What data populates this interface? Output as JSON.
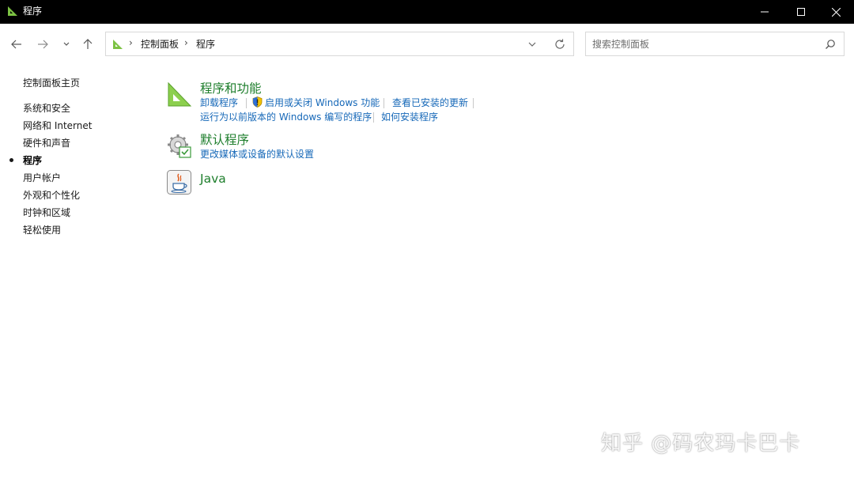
{
  "window": {
    "title": "程序",
    "controls": [
      "minimize-icon",
      "maximize-icon",
      "close-icon"
    ]
  },
  "navigation": {
    "back_icon": "arrow-left-icon",
    "forward_icon": "arrow-right-icon",
    "recent_icon": "chevron-down-icon",
    "up_icon": "arrow-up-icon"
  },
  "address": {
    "breadcrumbs": [
      "控制面板",
      "程序"
    ],
    "separator": "›"
  },
  "search": {
    "placeholder": "搜索控制面板",
    "value": ""
  },
  "sidebar": {
    "items": [
      {
        "label": "控制面板主页"
      },
      {
        "label": "系统和安全"
      },
      {
        "label": "网络和 Internet"
      },
      {
        "label": "硬件和声音"
      },
      {
        "label": "程序",
        "current": true
      },
      {
        "label": "用户帐户"
      },
      {
        "label": "外观和个性化"
      },
      {
        "label": "时钟和区域"
      },
      {
        "label": "轻松使用"
      }
    ]
  },
  "categories": [
    {
      "title": "程序和功能",
      "icon": "programs-features-icon",
      "links": [
        "卸载程序",
        "启用或关闭 Windows 功能",
        "查看已安装的更新",
        "运行为以前版本的 Windows 编写的程序",
        "如何安装程序"
      ]
    },
    {
      "title": "默认程序",
      "icon": "default-programs-icon",
      "links": [
        "更改媒体或设备的默认设置"
      ]
    },
    {
      "title": "Java",
      "icon": "java-icon",
      "links": []
    }
  ],
  "watermark": "知乎 @码农玛卡巴卡",
  "colors": {
    "titlebar": "#000000",
    "category_title": "#1e7e2c",
    "link": "#1668b8"
  }
}
